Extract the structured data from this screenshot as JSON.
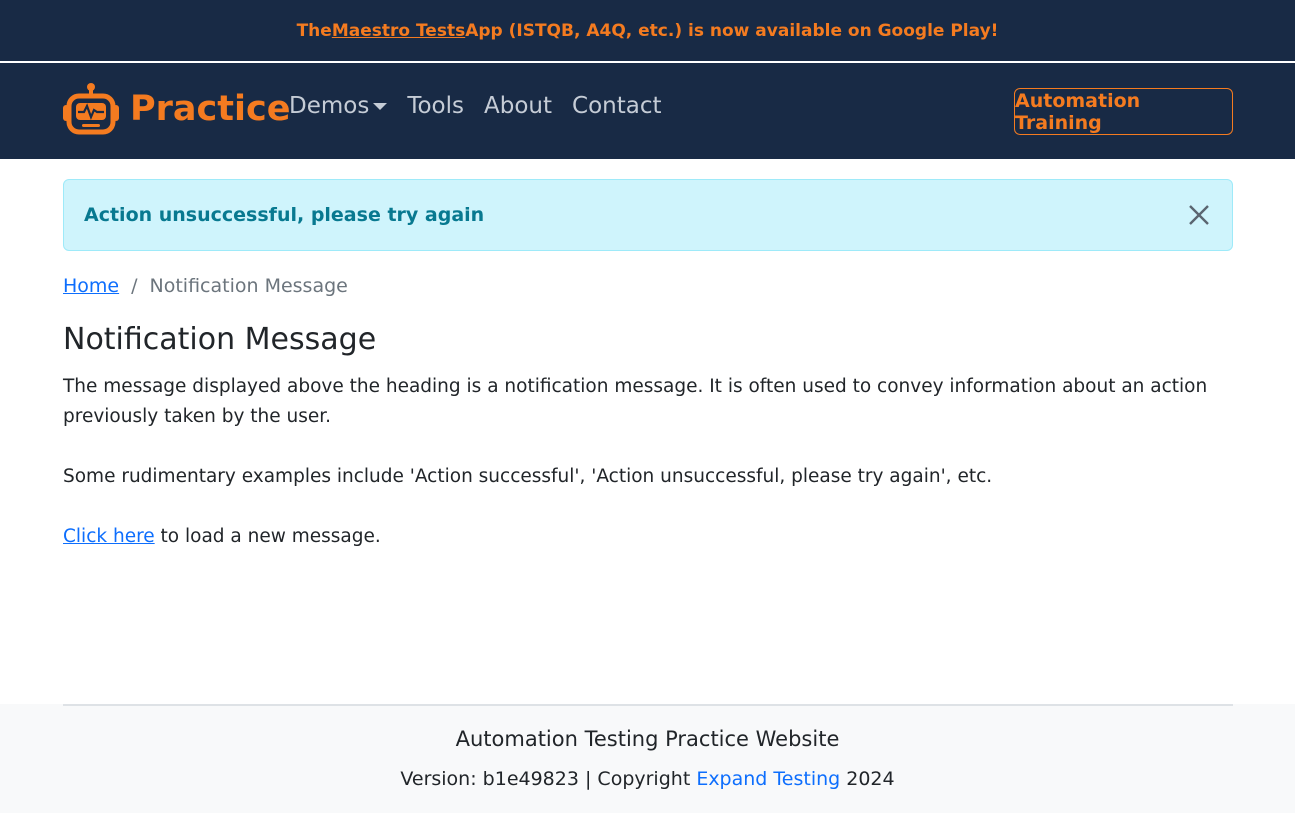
{
  "promo": {
    "prefix": "The ",
    "link": "Maestro Tests",
    "suffix": " App (ISTQB, A4Q, etc.) is now available on Google Play!"
  },
  "navbar": {
    "brand": "Practice",
    "links": [
      "Demos",
      "Tools",
      "About",
      "Contact"
    ],
    "cta": "Automation Training"
  },
  "alert": {
    "message": "Action unsuccessful, please try again"
  },
  "breadcrumb": {
    "home": "Home",
    "separator": "/",
    "current": "Notification Message"
  },
  "page": {
    "title": "Notification Message",
    "p1": "The message displayed above the heading is a notification message. It is often used to convey information about an action previously taken by the user.",
    "p2": "Some rudimentary examples include 'Action successful', 'Action unsuccessful, please try again', etc.",
    "p3_link": "Click here",
    "p3_rest": " to load a new message."
  },
  "footer": {
    "title": "Automation Testing Practice Website",
    "version_prefix": "Version: b1e49823 | Copyright ",
    "link": "Expand Testing",
    "year": " 2024"
  },
  "colors": {
    "navy": "#182a45",
    "orange": "#f47b20",
    "alert_bg": "#cff4fc",
    "link": "#0d6efd"
  }
}
